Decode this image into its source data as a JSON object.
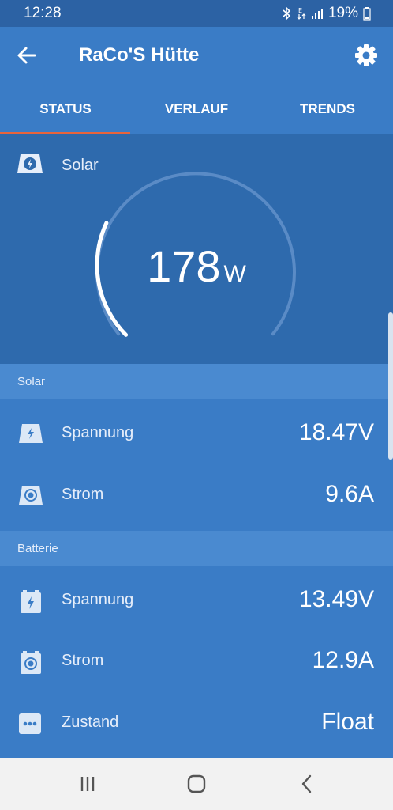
{
  "status_bar": {
    "time": "12:28",
    "battery": "19%"
  },
  "app_bar": {
    "title": "RaCo'S Hütte"
  },
  "tabs": [
    {
      "label": "STATUS",
      "active": true
    },
    {
      "label": "VERLAUF",
      "active": false
    },
    {
      "label": "TRENDS",
      "active": false
    }
  ],
  "hero": {
    "label": "Solar",
    "value": "178",
    "unit": "W",
    "gauge_fraction": 0.26
  },
  "sections": [
    {
      "title": "Solar",
      "rows": [
        {
          "icon": "solar-bolt-icon",
          "label": "Spannung",
          "value": "18.47V"
        },
        {
          "icon": "solar-current-icon",
          "label": "Strom",
          "value": "9.6A"
        }
      ]
    },
    {
      "title": "Batterie",
      "rows": [
        {
          "icon": "battery-bolt-icon",
          "label": "Spannung",
          "value": "13.49V"
        },
        {
          "icon": "battery-current-icon",
          "label": "Strom",
          "value": "12.9A"
        },
        {
          "icon": "state-dots-icon",
          "label": "Zustand",
          "value": "Float"
        }
      ]
    }
  ],
  "colors": {
    "primary": "#3a7cc6",
    "dark": "#2e6aad",
    "section": "#4a8ad0",
    "accent": "#e8643c"
  }
}
